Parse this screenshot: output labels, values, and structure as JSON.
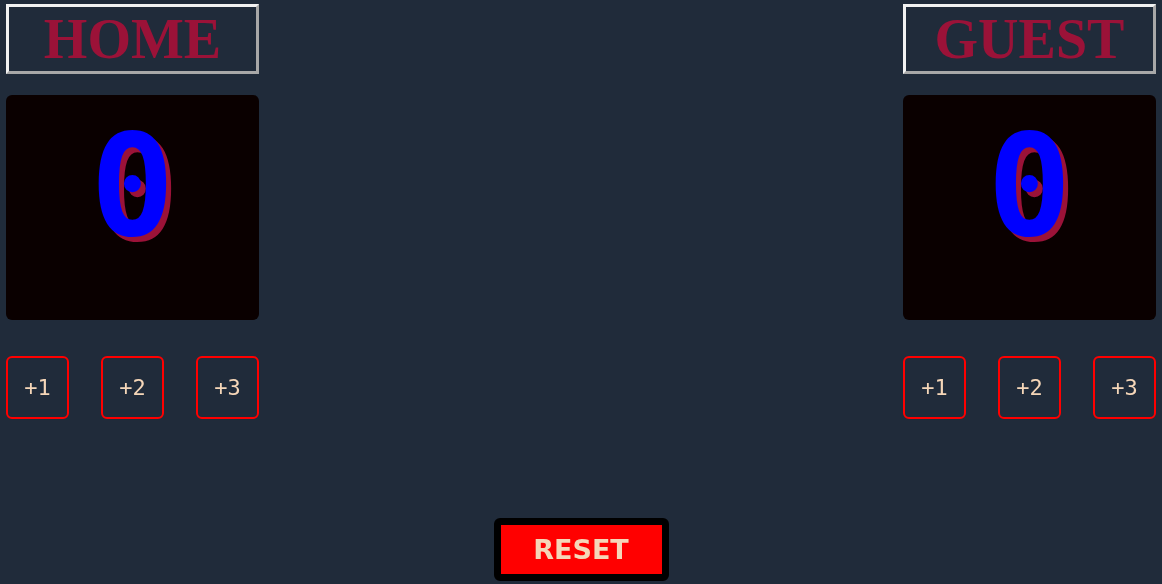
{
  "teams": [
    {
      "name": "HOME",
      "score": "0",
      "buttons": [
        "+1",
        "+2",
        "+3"
      ]
    },
    {
      "name": "GUEST",
      "score": "0",
      "buttons": [
        "+1",
        "+2",
        "+3"
      ]
    }
  ],
  "reset_button": "RESET"
}
